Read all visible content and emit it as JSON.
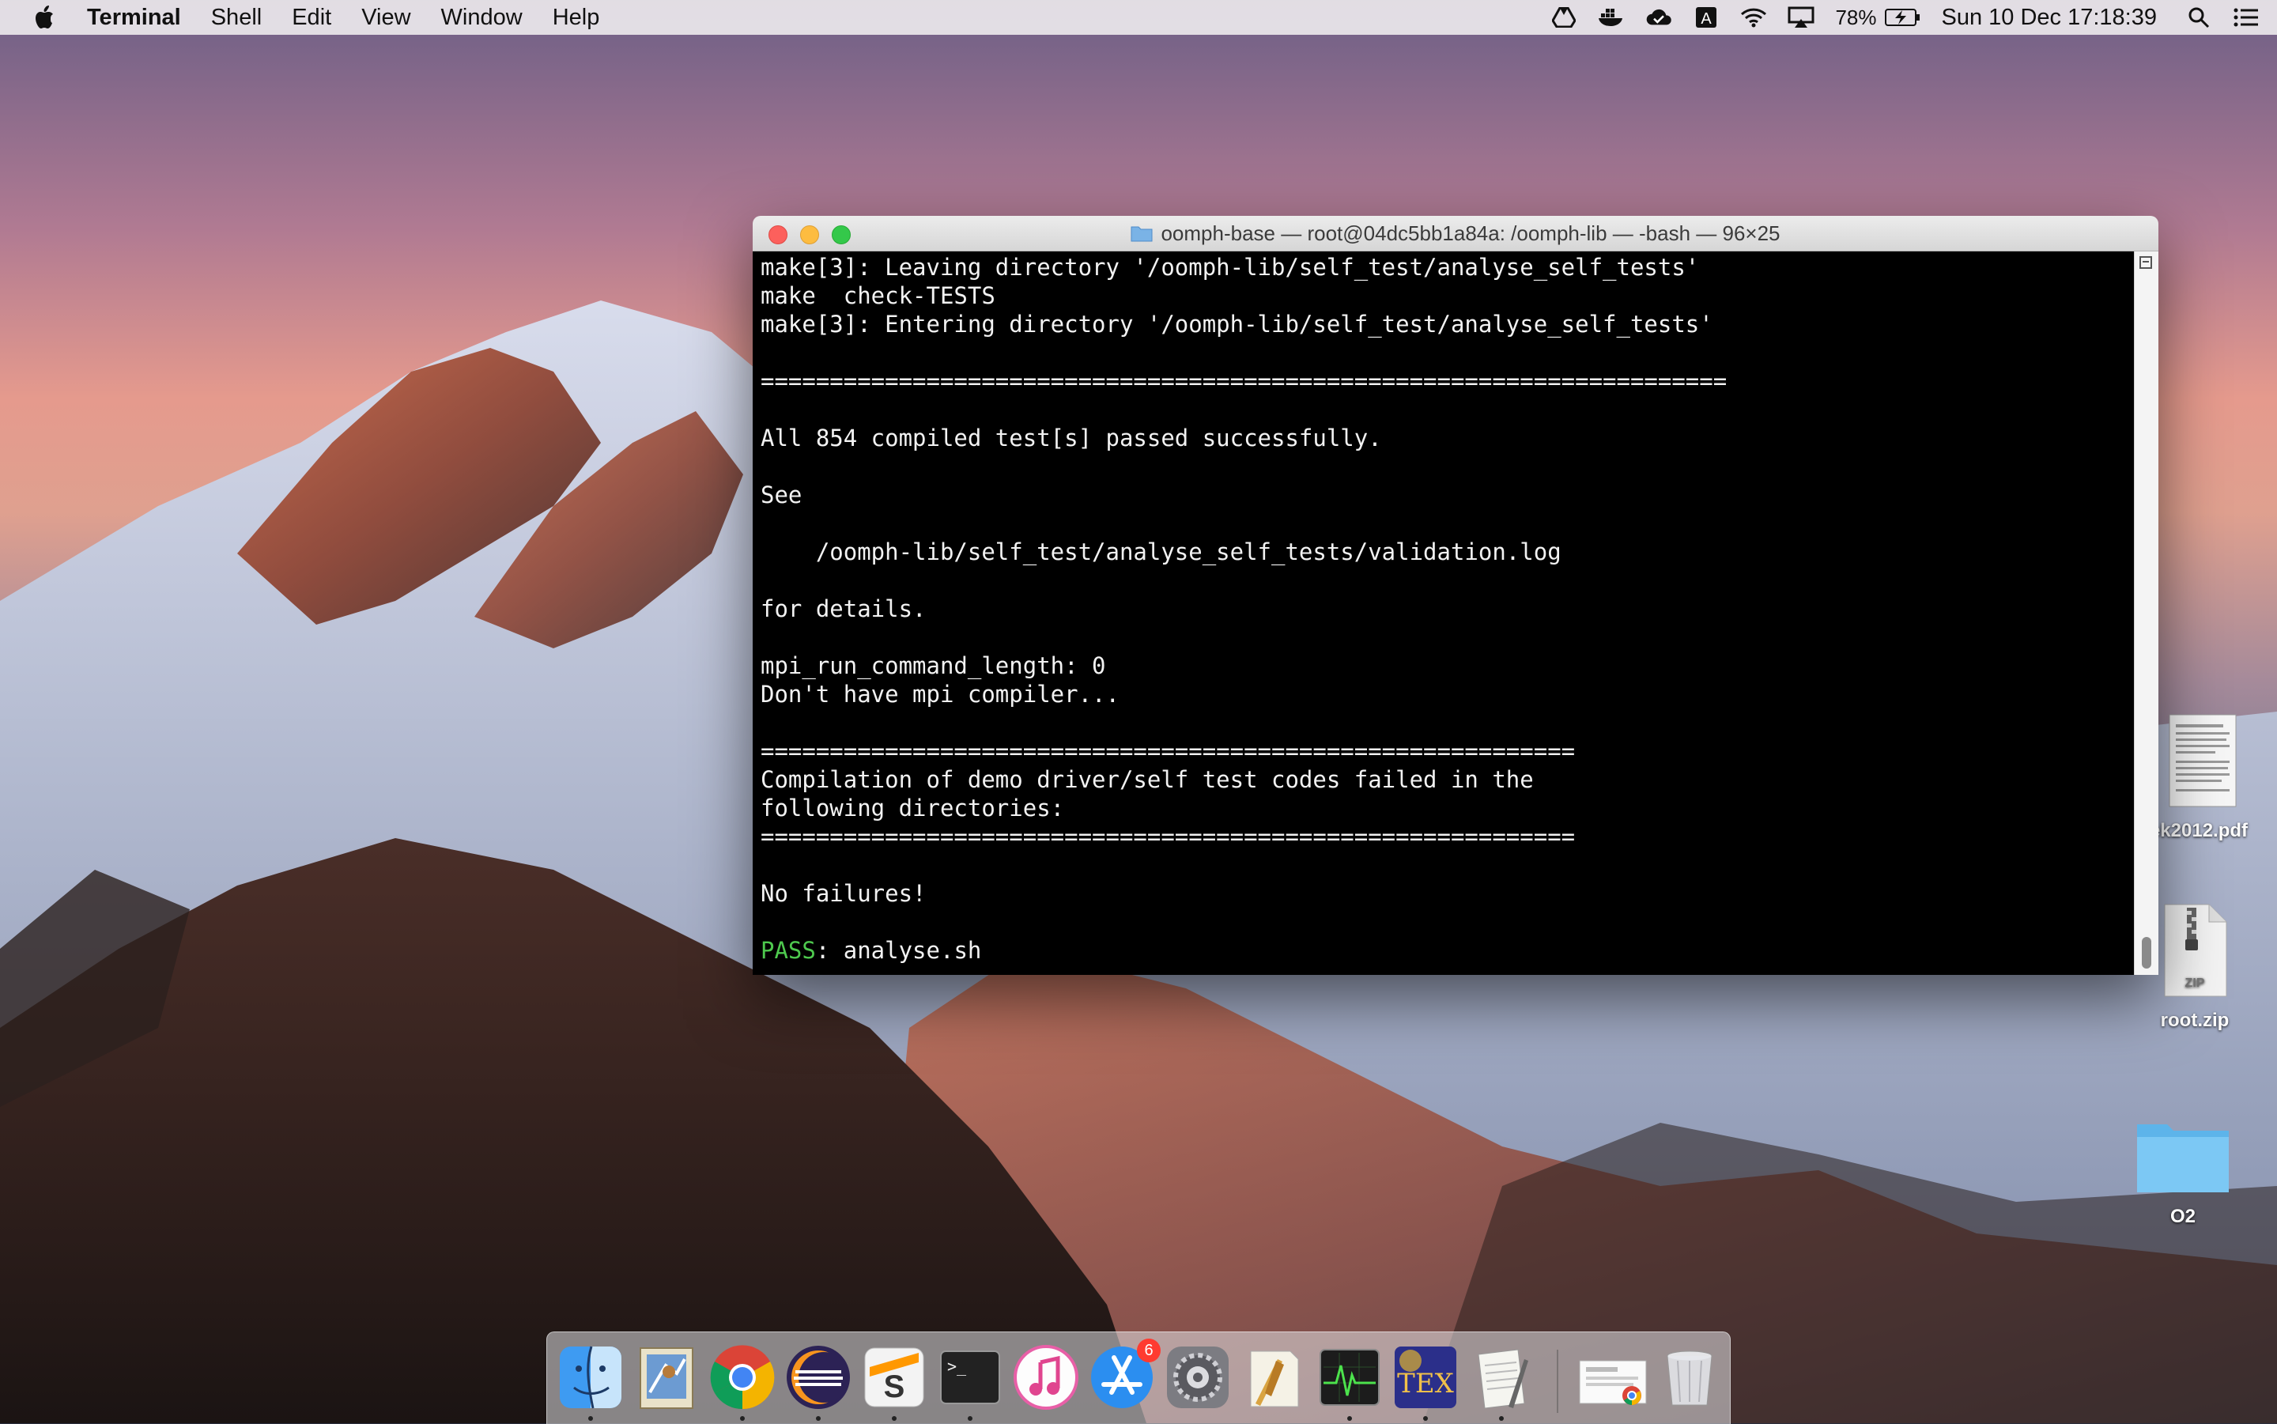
{
  "menubar": {
    "app_name": "Terminal",
    "menus": [
      "Shell",
      "Edit",
      "View",
      "Window",
      "Help"
    ],
    "battery": "78%",
    "clock": "Sun 10 Dec  17:18:39"
  },
  "terminal": {
    "title": "oomph-base — root@04dc5bb1a84a: /oomph-lib — -bash — 96×25",
    "lines": [
      "make[3]: Leaving directory '/oomph-lib/self_test/analyse_self_tests'",
      "make  check-TESTS",
      "make[3]: Entering directory '/oomph-lib/self_test/analyse_self_tests'",
      "",
      "======================================================================",
      "",
      "All 854 compiled test[s] passed successfully.",
      "",
      "See",
      "",
      "    /oomph-lib/self_test/analyse_self_tests/validation.log",
      "",
      "for details.",
      "",
      "mpi_run_command_length: 0",
      "Don't have mpi compiler...",
      "",
      "===========================================================",
      "Compilation of demo driver/self test codes failed in the",
      "following directories:",
      "===========================================================",
      "",
      "No failures!",
      ""
    ],
    "pass_label": "PASS",
    "pass_rest": ": analyse.sh"
  },
  "desktop": {
    "icons": [
      {
        "label": "ek2012.pdf"
      },
      {
        "label": "root.zip",
        "badge": "ZIP"
      },
      {
        "label": "O2"
      }
    ]
  },
  "dock": {
    "apps": [
      "finder-icon",
      "mail-icon",
      "chrome-icon",
      "eclipse-icon",
      "sublime-icon",
      "terminal-icon",
      "itunes-icon",
      "app-store-icon",
      "system-preferences-icon",
      "textedit-icon",
      "activity-monitor-icon",
      "texshop-icon",
      "notes-icon",
      "downloads-icon",
      "trash-icon"
    ],
    "app_store_badge": "6"
  }
}
